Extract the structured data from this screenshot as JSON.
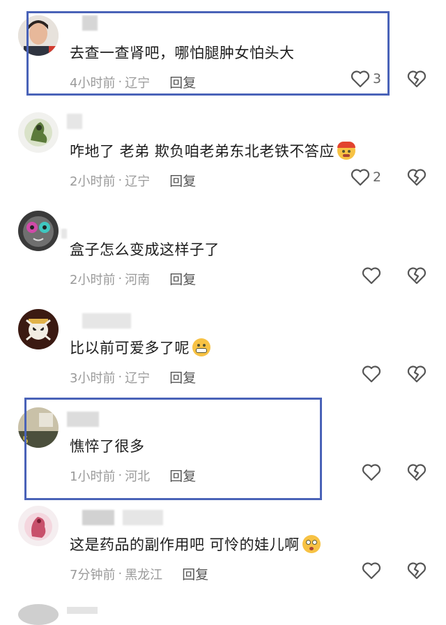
{
  "comments": [
    {
      "text": "去查一查肾吧，哪怕腿肿女怕头大",
      "time": "4小时前",
      "location": "辽宁",
      "reply": "回复",
      "likes": "3",
      "emoji": ""
    },
    {
      "text": "咋地了 老弟  欺负咱老弟东北老铁不答应",
      "time": "2小时前",
      "location": "辽宁",
      "reply": "回复",
      "likes": "2",
      "emoji": "angry-face-emoji"
    },
    {
      "text": "盒子怎么变成这样子了",
      "time": "2小时前",
      "location": "河南",
      "reply": "回复",
      "likes": "",
      "emoji": ""
    },
    {
      "text": "比以前可爱多了呢",
      "time": "3小时前",
      "location": "辽宁",
      "reply": "回复",
      "likes": "",
      "emoji": "grinning-face-emoji"
    },
    {
      "text": "憔悴了很多",
      "time": "1小时前",
      "location": "河北",
      "reply": "回复",
      "likes": "",
      "emoji": ""
    },
    {
      "text": "这是药品的副作用吧   可怜的娃儿啊",
      "time": "7分钟前",
      "location": "黑龙江",
      "reply": "回复",
      "likes": "",
      "emoji": "flushed-face-emoji"
    }
  ],
  "separator": "·",
  "colors": {
    "highlight_box": "#4a63b8",
    "meta_text": "#9a9a9a",
    "body_text": "#1d1d1d"
  }
}
